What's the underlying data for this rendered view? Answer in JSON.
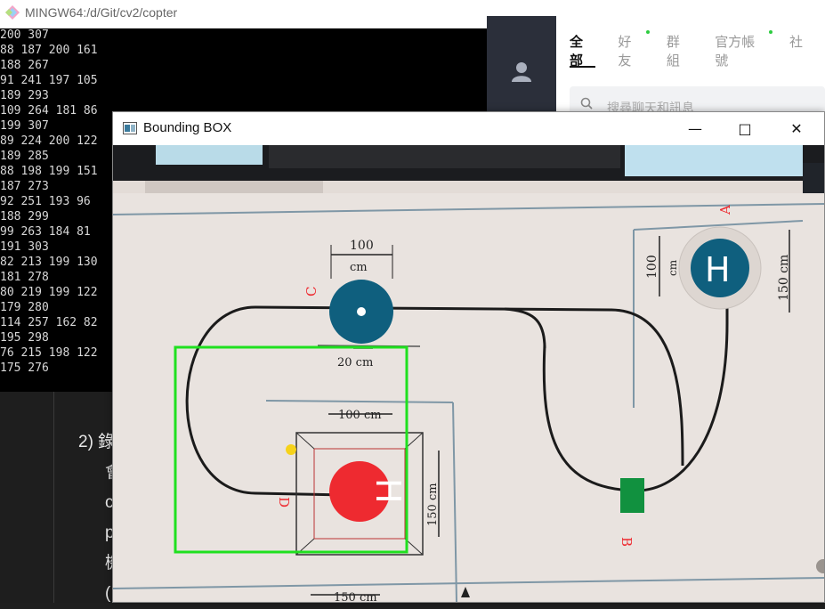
{
  "terminal": {
    "title": "MINGW64:/d/Git/cv2/copter",
    "lines": [
      "200 307",
      "88 187 200 161",
      "188 267",
      "91 241 197 105",
      "189 293",
      "109 264 181 86",
      "199 307",
      "89 224 200 122",
      "189 285",
      "88 198 199 151",
      "187 273",
      "92 251 193 96",
      "188 299",
      "99 263 184 81",
      "191 303",
      "82 213 199 130",
      "181 278",
      "80 219 199 122",
      "179 280",
      "114 257 162 82",
      "195 298",
      "76 215 198 122",
      "175 276"
    ],
    "minimize_icon": "minimize-icon",
    "maximize_icon": "maximize-icon",
    "close_icon": "close-icon"
  },
  "editor": {
    "lines": [
      "2) 錄",
      "會",
      "c",
      "p",
      "機",
      "("
    ]
  },
  "line_app": {
    "tabs": [
      {
        "label": "全部",
        "active": true,
        "dot": false
      },
      {
        "label": "好友",
        "active": false,
        "dot": true
      },
      {
        "label": "群組",
        "active": false,
        "dot": false
      },
      {
        "label": "官方帳號",
        "active": false,
        "dot": true
      },
      {
        "label": "社",
        "active": false,
        "dot": false
      }
    ],
    "search_placeholder": "搜尋聊天和訊息",
    "dot_color": "#2ecc40"
  },
  "bbox_window": {
    "title": "Bounding BOX",
    "map": {
      "label_A": "A",
      "label_B": "B",
      "label_C": "C",
      "label_D": "D",
      "dim_top": "100",
      "dim_top_unit": "cm",
      "dim_20": "20 cm",
      "dim_100cm": "100 cm",
      "dim_150cm_a": "150 cm",
      "dim_100_a": "100",
      "dim_100_a_unit": "cm",
      "dim_150cm_d": "150 cm",
      "dim_bottom": "150 cm",
      "helipad_letter": "H"
    },
    "colors": {
      "bounding_box": "#1fe01f",
      "marker": "#f6d21a",
      "pad_blue": "#0f5f7e",
      "pad_red": "#ee2a30",
      "pad_green": "#11913f"
    }
  }
}
